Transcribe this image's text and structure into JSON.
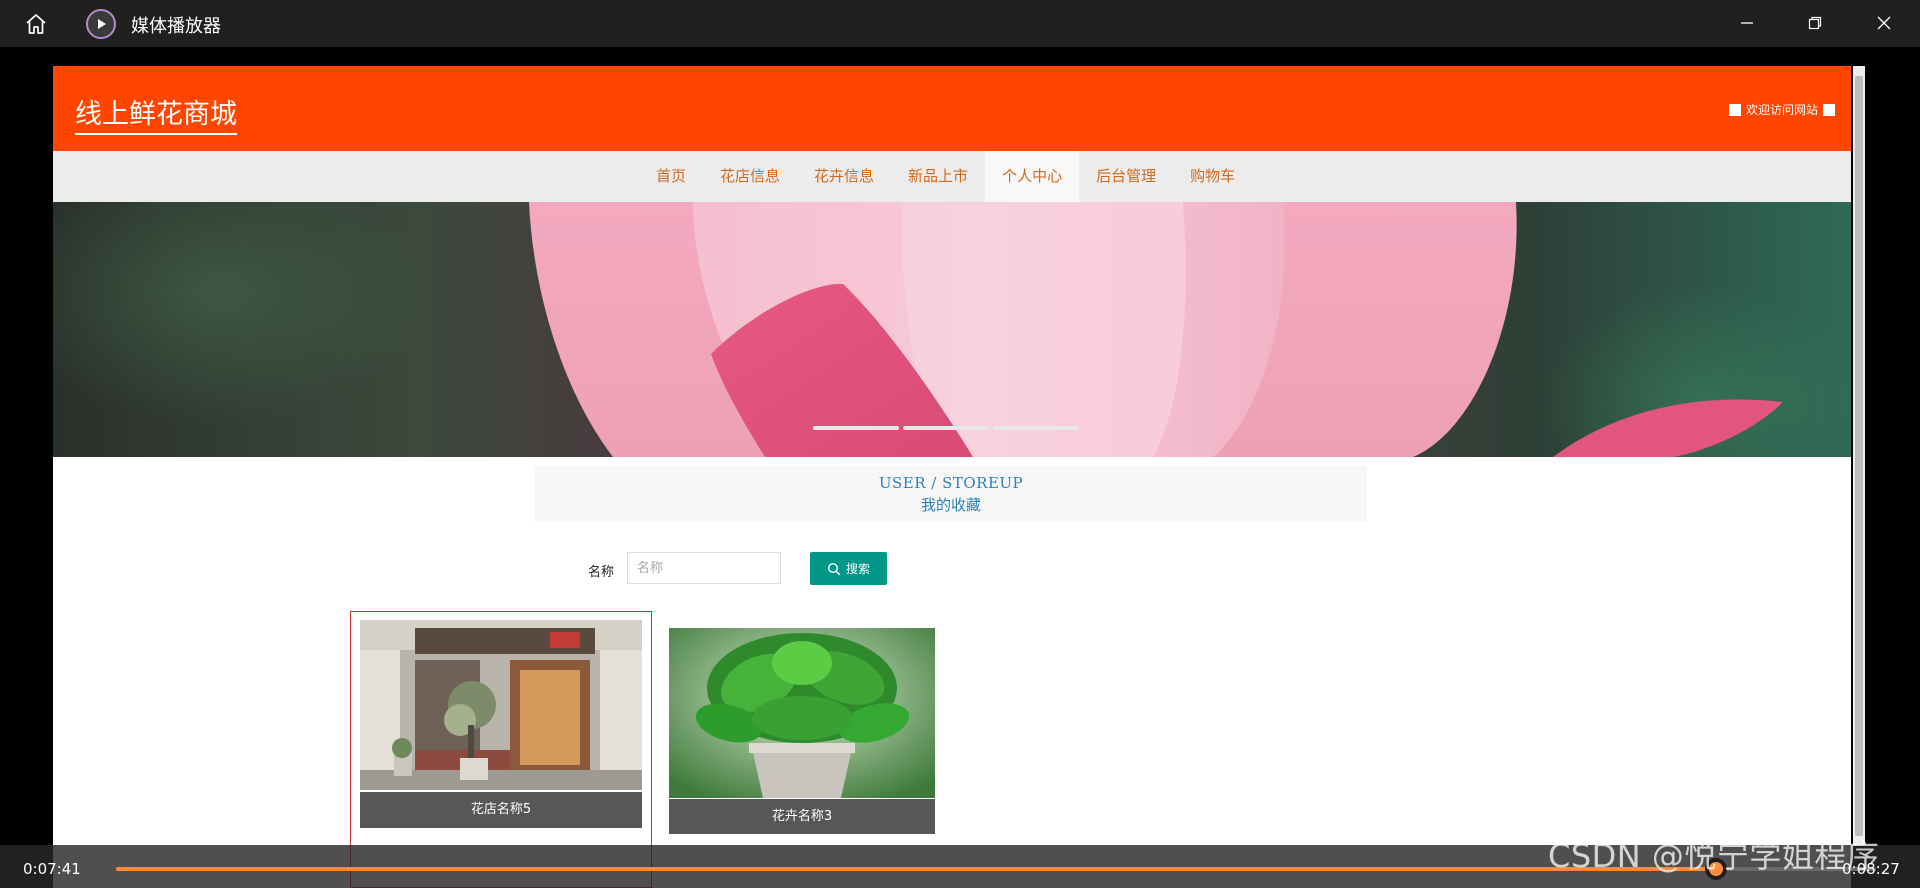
{
  "player": {
    "title": "媒体播放器",
    "current_time": "0:07:41",
    "total_time": "0:08:27",
    "progress": 0.909,
    "accent": "#ff8a3d"
  },
  "site": {
    "logo": "线上鲜花商城",
    "welcome": "欢迎访问网站",
    "brand_color": "#ff4500"
  },
  "nav": {
    "items": [
      "首页",
      "花店信息",
      "花卉信息",
      "新品上市",
      "个人中心",
      "后台管理",
      "购物车"
    ],
    "active_index": 4
  },
  "banner": {
    "slide_count": 3,
    "active_index": 0
  },
  "section": {
    "title_en": "USER / STOREUP",
    "title_cn": "我的收藏"
  },
  "search": {
    "label": "名称",
    "placeholder": "名称",
    "button_label": "搜索"
  },
  "cards": [
    {
      "name": "花店名称5",
      "image": "storefront-photo"
    },
    {
      "name": "花卉名称3",
      "image": "potted-plant-photo"
    }
  ],
  "watermark": "CSDN @悦宁学姐程序"
}
